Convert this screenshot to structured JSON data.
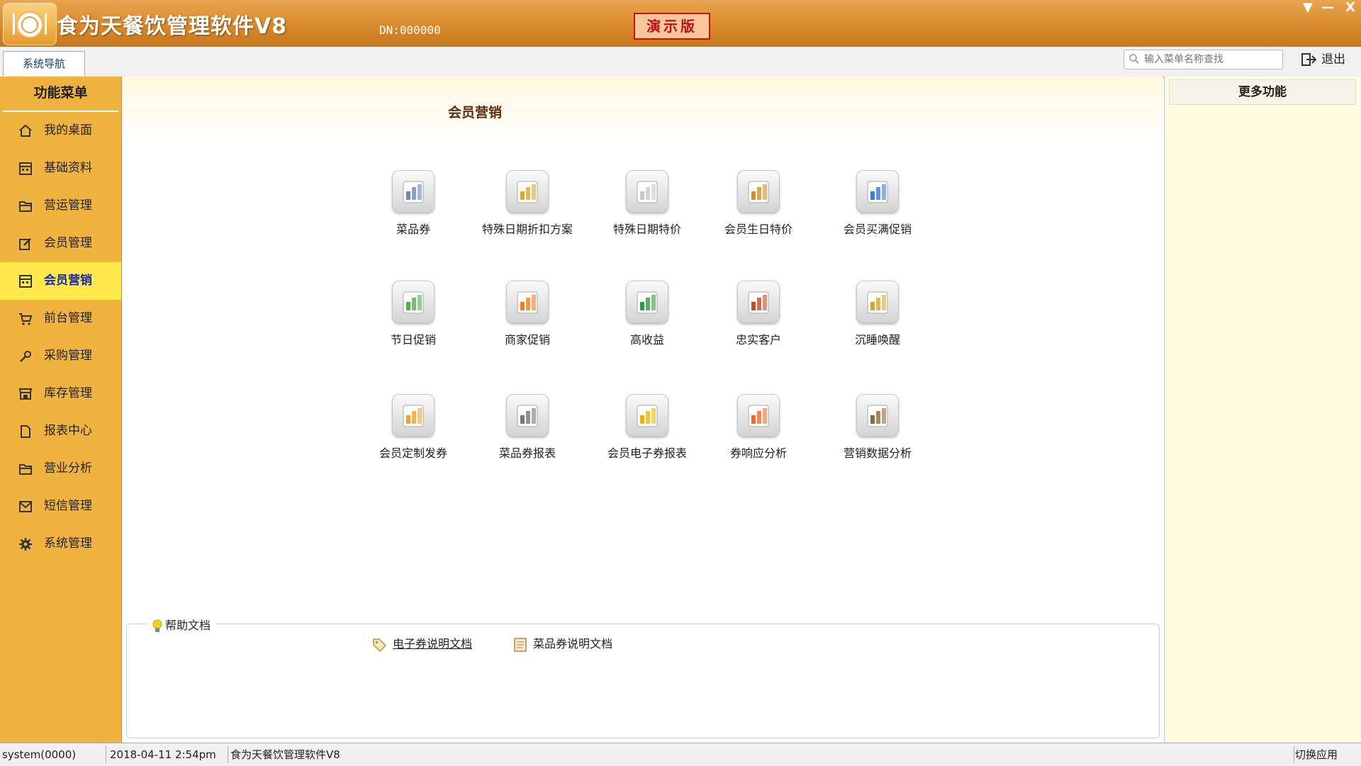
{
  "titlebar": {
    "app_title": "食为天餐饮管理软件V8",
    "dn": "DN:000000",
    "demo_badge": "演示版",
    "controls": [
      "▼",
      "—",
      "X"
    ]
  },
  "toolbar": {
    "nav_tab": "系统导航",
    "search_placeholder": "输入菜单名称查找",
    "logout": "退出"
  },
  "sidebar": {
    "header": "功能菜单",
    "items": [
      {
        "label": "我的桌面",
        "icon": "home-icon"
      },
      {
        "label": "基础资料",
        "icon": "calculator-icon"
      },
      {
        "label": "营运管理",
        "icon": "folder-icon"
      },
      {
        "label": "会员管理",
        "icon": "edit-icon"
      },
      {
        "label": "会员营销",
        "icon": "calculator-icon",
        "active": true
      },
      {
        "label": "前台管理",
        "icon": "cart-icon"
      },
      {
        "label": "采购管理",
        "icon": "wrench-icon"
      },
      {
        "label": "库存管理",
        "icon": "store-icon"
      },
      {
        "label": "报表中心",
        "icon": "document-icon"
      },
      {
        "label": "营业分析",
        "icon": "folder-icon"
      },
      {
        "label": "短信管理",
        "icon": "message-icon"
      },
      {
        "label": "系统管理",
        "icon": "gear-icon"
      }
    ]
  },
  "main": {
    "section_title": "会员营销",
    "features": [
      {
        "label": "菜品券",
        "icon": "gear-user-icon",
        "color": "#6a8bb5"
      },
      {
        "label": "特殊日期折扣方案",
        "icon": "money-cards-icon",
        "color": "#d9a72a"
      },
      {
        "label": "特殊日期特价",
        "icon": "price-doc-icon",
        "color": "#c8c8c8"
      },
      {
        "label": "会员生日特价",
        "icon": "member-card-icon",
        "color": "#d98b2a"
      },
      {
        "label": "会员买满促销",
        "icon": "bar-chart-dollar-icon",
        "color": "#3a7bd5"
      },
      {
        "label": "节日促销",
        "icon": "person-doc-icon",
        "color": "#4caf50"
      },
      {
        "label": "商家促销",
        "icon": "orange-doc-icon",
        "color": "#f47a1f"
      },
      {
        "label": "高收益",
        "icon": "rising-chart-icon",
        "color": "#2e9b3f"
      },
      {
        "label": "忠实客户",
        "icon": "people-chart-icon",
        "color": "#c84a2a"
      },
      {
        "label": "沉睡唤醒",
        "icon": "notebook-icon",
        "color": "#e0a030"
      },
      {
        "label": "会员定制发券",
        "icon": "folder-gear-icon",
        "color": "#f0a028"
      },
      {
        "label": "菜品券报表",
        "icon": "printer-icon",
        "color": "#777777"
      },
      {
        "label": "会员电子券报表",
        "icon": "star-doc-icon",
        "color": "#f0b400"
      },
      {
        "label": "券响应分析",
        "icon": "clock-refresh-icon",
        "color": "#f36a24"
      },
      {
        "label": "营销数据分析",
        "icon": "clipboard-icon",
        "color": "#8a6a3a"
      }
    ]
  },
  "help": {
    "title": "帮助文档",
    "links": [
      {
        "label": "电子券说明文档",
        "icon": "tag-icon"
      },
      {
        "label": "菜品券说明文档",
        "icon": "text-doc-icon"
      }
    ]
  },
  "rightpanel": {
    "header": "更多功能"
  },
  "status": {
    "user": "system(0000)",
    "datetime": "2018-04-11 2:54pm",
    "app": "食为天餐饮管理软件V8",
    "switch": "切换应用"
  }
}
